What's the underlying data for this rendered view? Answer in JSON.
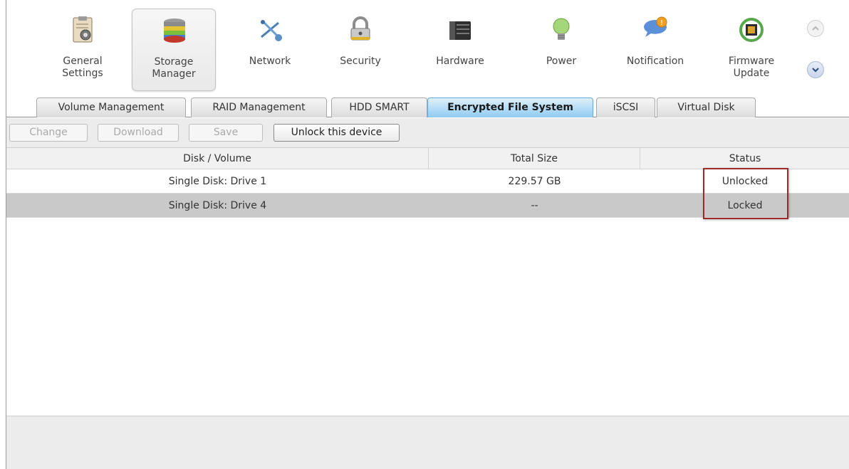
{
  "categories": [
    {
      "label": "General\nSettings",
      "icon": "general-settings-icon",
      "active": false
    },
    {
      "label": "Storage\nManager",
      "icon": "storage-manager-icon",
      "active": true
    },
    {
      "label": "Network",
      "icon": "network-icon",
      "active": false
    },
    {
      "label": "Security",
      "icon": "security-icon",
      "active": false
    },
    {
      "label": "Hardware",
      "icon": "hardware-icon",
      "active": false
    },
    {
      "label": "Power",
      "icon": "power-icon",
      "active": false
    },
    {
      "label": "Notification",
      "icon": "notification-icon",
      "active": false
    },
    {
      "label": "Firmware\nUpdate",
      "icon": "firmware-update-icon",
      "active": false
    }
  ],
  "tabs": [
    {
      "label": "Volume Management",
      "active": false
    },
    {
      "label": "RAID Management",
      "active": false
    },
    {
      "label": "HDD SMART",
      "active": false
    },
    {
      "label": "Encrypted File System",
      "active": true
    },
    {
      "label": "iSCSI",
      "active": false
    },
    {
      "label": "Virtual Disk",
      "active": false
    }
  ],
  "toolbar": {
    "change": "Change",
    "download": "Download",
    "save": "Save",
    "unlock": "Unlock this device"
  },
  "table": {
    "headers": [
      "Disk / Volume",
      "Total Size",
      "Status"
    ],
    "rows": [
      {
        "disk": "Single Disk: Drive 1",
        "size": "229.57 GB",
        "status": "Unlocked"
      },
      {
        "disk": "Single Disk: Drive 4",
        "size": "--",
        "status": "Locked"
      }
    ]
  },
  "colors": {
    "active_tab": "#8fcbf1",
    "selected_row": "#c9c9c9",
    "highlight_box": "#9b2b2b"
  }
}
